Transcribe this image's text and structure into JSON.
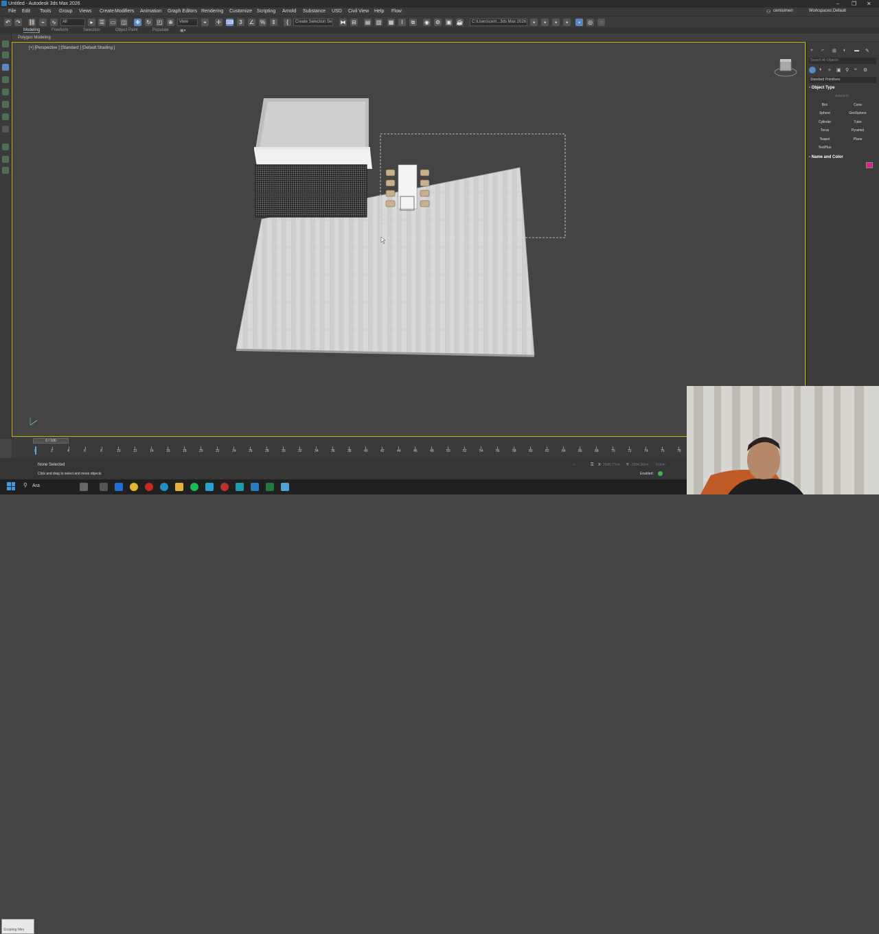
{
  "window": {
    "title": "Untitled - Autodesk 3ds Max 2026"
  },
  "menu": [
    "File",
    "Edit",
    "Tools",
    "Group",
    "Views",
    "Create",
    "Modifiers",
    "Animation",
    "Graph Editors",
    "Rendering",
    "Customize",
    "Scripting",
    "Arnold",
    "Substance",
    "USD",
    "Civil View",
    "Help",
    "Flow"
  ],
  "user": {
    "name": "cemisimen",
    "workspaces_label": "Workspaces:",
    "workspace": "Default"
  },
  "toolbar": {
    "filter": "All",
    "view_dropdown": "View",
    "selection_set": "Create Selection Se",
    "project_path": "C:\\Users\\cem...3ds Max 2026"
  },
  "ribbon": {
    "tabs": [
      "Modeling",
      "Freeform",
      "Selection",
      "Object Paint",
      "Populate"
    ],
    "sub_label": "Polygon Modeling"
  },
  "viewport": {
    "label": "[+] [Perspective ] [Standard ] [Default Shading ]"
  },
  "command_panel": {
    "search_placeholder": "Search All Objects",
    "category": "Standard Primitives",
    "object_type_title": "Object Type",
    "autogrid": "AutoGrid",
    "buttons": [
      "Box",
      "Cone",
      "Sphere",
      "GeoSphere",
      "Cylinder",
      "Tube",
      "Torus",
      "Pyramid",
      "Teapot",
      "Plane",
      "TextPlus"
    ],
    "name_color_title": "Name and Color",
    "color": "#e0218a"
  },
  "timeline": {
    "frame_display": "0 / 100",
    "ticks": [
      "0",
      "2",
      "4",
      "6",
      "8",
      "10",
      "12",
      "14",
      "16",
      "18",
      "20",
      "22",
      "24",
      "26",
      "28",
      "30",
      "32",
      "34",
      "36",
      "38",
      "40",
      "42",
      "44",
      "46",
      "48",
      "50",
      "52",
      "54",
      "56",
      "58",
      "60",
      "62",
      "64",
      "66",
      "68",
      "70",
      "72",
      "74",
      "76",
      "78"
    ]
  },
  "status": {
    "scripting_label": "Scripting Mini",
    "selection": "None Selected",
    "prompt": "Click and drag to select and move objects",
    "x_value": "2546,77cm",
    "y_value": "-1304,38cm",
    "z_value": "0,0cm",
    "enabled": "Enabled:"
  },
  "taskbar": {
    "search": "Ara"
  }
}
